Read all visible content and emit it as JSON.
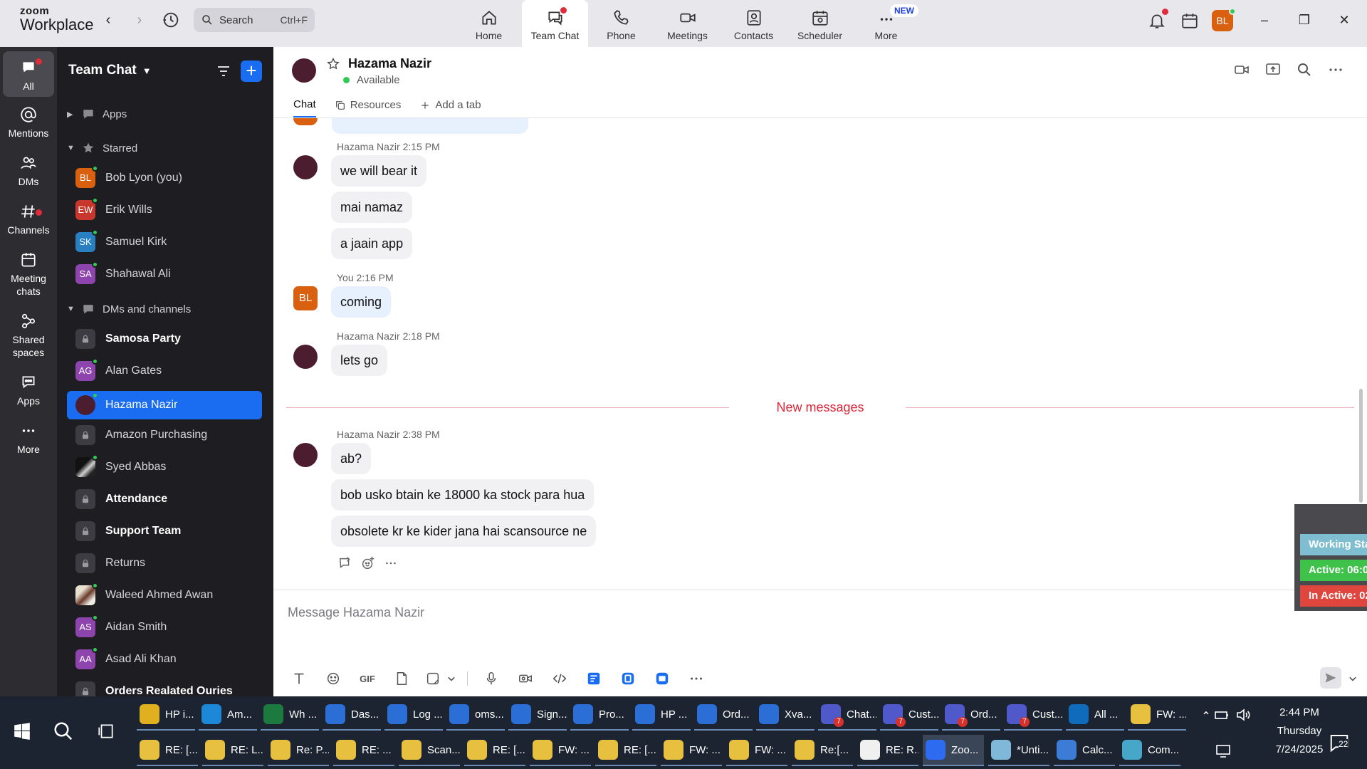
{
  "app": {
    "logo_top": "zoom",
    "logo_bottom": "Workplace"
  },
  "search": {
    "label": "Search",
    "shortcut": "Ctrl+F"
  },
  "topnav": [
    {
      "label": "Home",
      "icon": "home-icon"
    },
    {
      "label": "Team Chat",
      "icon": "chat-icon"
    },
    {
      "label": "Phone",
      "icon": "phone-icon"
    },
    {
      "label": "Meetings",
      "icon": "video-icon"
    },
    {
      "label": "Contacts",
      "icon": "contacts-icon"
    },
    {
      "label": "Scheduler",
      "icon": "calendar-icon"
    },
    {
      "label": "More",
      "icon": "more-icon",
      "badge": "NEW"
    }
  ],
  "user": {
    "initials": "BL",
    "color": "#d9600f"
  },
  "rail": [
    {
      "label": "All"
    },
    {
      "label": "Mentions"
    },
    {
      "label": "DMs"
    },
    {
      "label": "Channels"
    },
    {
      "label": "Meeting chats"
    },
    {
      "label": "Shared spaces"
    },
    {
      "label": "Apps"
    },
    {
      "label": "More"
    }
  ],
  "sidebar": {
    "title": "Team Chat",
    "sections": {
      "apps": "Apps",
      "starred": "Starred",
      "dms": "DMs and channels"
    },
    "starred": [
      {
        "label": "Bob Lyon (you)",
        "initials": "BL",
        "color": "#d9600f"
      },
      {
        "label": "Erik Wills",
        "initials": "EW",
        "color": "#c8372d"
      },
      {
        "label": "Samuel Kirk",
        "initials": "SK",
        "color": "#2a7fc1"
      },
      {
        "label": "Shahawal Ali",
        "initials": "SA",
        "color": "#8e44ad"
      }
    ],
    "channels": [
      {
        "label": "Samosa Party",
        "type": "lock",
        "bold": true
      },
      {
        "label": "Alan Gates",
        "initials": "AG",
        "color": "#8e44ad"
      },
      {
        "label": "Hazama Nazir",
        "type": "maroon"
      },
      {
        "label": "Amazon Purchasing",
        "type": "lock"
      },
      {
        "label": "Syed Abbas",
        "type": "photo"
      },
      {
        "label": "Attendance",
        "type": "lock",
        "bold": true
      },
      {
        "label": "Support Team",
        "type": "lock",
        "bold": true
      },
      {
        "label": "Returns",
        "type": "lock"
      },
      {
        "label": "Waleed Ahmed Awan",
        "type": "photo"
      },
      {
        "label": "Aidan Smith",
        "initials": "AS",
        "color": "#8e44ad"
      },
      {
        "label": "Asad Ali Khan",
        "initials": "AA",
        "color": "#8e44ad"
      },
      {
        "label": "Orders Realated Ouries",
        "type": "lock",
        "bold": true
      }
    ]
  },
  "chat": {
    "name": "Hazama Nazir",
    "status": "Available",
    "tabs": {
      "chat": "Chat",
      "resources": "Resources",
      "add": "Add a tab"
    },
    "groups": [
      {
        "meta": "Hazama Nazir 2:15 PM",
        "mine": false,
        "messages": [
          "we will bear it",
          "mai namaz",
          "a jaain app"
        ]
      },
      {
        "meta": "You 2:16 PM",
        "mine": true,
        "initials": "BL",
        "messages": [
          "coming"
        ]
      },
      {
        "meta": "Hazama Nazir 2:18 PM",
        "mine": false,
        "messages": [
          "lets go"
        ]
      },
      {
        "meta": "Hazama Nazir 2:38 PM",
        "mine": false,
        "messages": [
          "ab?",
          "bob usko btain ke 18000 ka stock para hua",
          "obsolete kr ke kider jana hai scansource ne"
        ]
      }
    ],
    "new_messages": "New messages",
    "composer_placeholder": "Message Hazama Nazir",
    "gif_label": "GIF"
  },
  "widget": {
    "working": "Working Sta",
    "active": "Active: 06:0",
    "inactive": "In Active: 02"
  },
  "taskbar": {
    "row1": [
      {
        "label": "HP i...",
        "color": "#e0b020"
      },
      {
        "label": "Am...",
        "color": "#1e88d8"
      },
      {
        "label": "Wh ...",
        "color": "#1d7a3e"
      },
      {
        "label": "Das...",
        "color": "#2b6fd6"
      },
      {
        "label": "Log ...",
        "color": "#2b6fd6"
      },
      {
        "label": "oms...",
        "color": "#2b6fd6"
      },
      {
        "label": "Sign...",
        "color": "#2b6fd6"
      },
      {
        "label": "Pro...",
        "color": "#2b6fd6"
      },
      {
        "label": "HP ...",
        "color": "#2b6fd6"
      },
      {
        "label": "Ord...",
        "color": "#2b6fd6"
      },
      {
        "label": "Xva...",
        "color": "#2b6fd6"
      },
      {
        "label": "Chat...",
        "color": "#5059c9",
        "badge": "7"
      },
      {
        "label": "Cust...",
        "color": "#5059c9",
        "badge": "7"
      },
      {
        "label": "Ord...",
        "color": "#5059c9",
        "badge": "7"
      },
      {
        "label": "Cust...",
        "color": "#5059c9",
        "badge": "7"
      },
      {
        "label": "All ...",
        "color": "#0f6cbd"
      },
      {
        "label": "FW: ...",
        "color": "#e8c040"
      }
    ],
    "row2": [
      {
        "label": "RE: [...",
        "color": "#e8c040"
      },
      {
        "label": "RE: L...",
        "color": "#e8c040"
      },
      {
        "label": "Re: P...",
        "color": "#e8c040"
      },
      {
        "label": "RE: ...",
        "color": "#e8c040"
      },
      {
        "label": "Scan...",
        "color": "#e8c040"
      },
      {
        "label": "RE: [...",
        "color": "#e8c040"
      },
      {
        "label": "FW: ...",
        "color": "#e8c040"
      },
      {
        "label": "RE: [...",
        "color": "#e8c040"
      },
      {
        "label": "FW: ...",
        "color": "#e8c040"
      },
      {
        "label": "FW: ...",
        "color": "#e8c040"
      },
      {
        "label": "Re:[...",
        "color": "#e8c040"
      },
      {
        "label": "RE: R...",
        "color": "#f0f0f0"
      },
      {
        "label": "Zoo...",
        "color": "#2d6cf0"
      },
      {
        "label": "*Unti...",
        "color": "#7fb8d8"
      },
      {
        "label": "Calc...",
        "color": "#3c7bd6"
      },
      {
        "label": "Com...",
        "color": "#46a7c8"
      }
    ],
    "time": "2:44 PM",
    "day": "Thursday",
    "date": "7/24/2025",
    "notifications": "22"
  }
}
